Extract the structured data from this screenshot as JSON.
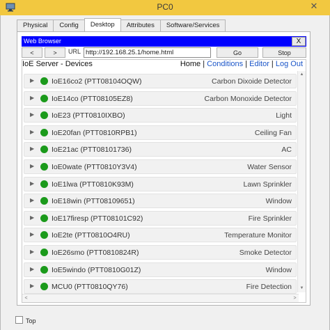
{
  "window": {
    "title": "PC0",
    "close_glyph": "✕"
  },
  "tabs": [
    {
      "label": "Physical",
      "active": false
    },
    {
      "label": "Config",
      "active": false
    },
    {
      "label": "Desktop",
      "active": true
    },
    {
      "label": "Attributes",
      "active": false
    },
    {
      "label": "Software/Services",
      "active": false
    }
  ],
  "browser": {
    "title": "Web Browser",
    "close_label": "X",
    "back_label": "<",
    "forward_label": ">",
    "url_label": "URL",
    "url_value": "http://192.168.25.1/home.html",
    "go_label": "Go",
    "stop_label": "Stop"
  },
  "page": {
    "title": "IoE Server - Devices",
    "links": [
      "Home",
      "Conditions",
      "Editor",
      "Log Out"
    ],
    "separator": " | "
  },
  "devices": [
    {
      "name": "IoE16co2 (PTT08104OQW)",
      "type": "Carbon Dixoide Detector",
      "status_color": "#1b9a1b"
    },
    {
      "name": "IoE14co (PTT08105EZ8)",
      "type": "Carbon Monoxide Detector",
      "status_color": "#1b9a1b"
    },
    {
      "name": "IoE23 (PTT0810IXBO)",
      "type": "Light",
      "status_color": "#1b9a1b"
    },
    {
      "name": "IoE20fan (PTT0810RPB1)",
      "type": "Ceiling Fan",
      "status_color": "#1b9a1b"
    },
    {
      "name": "IoE21ac (PTT08101736)",
      "type": "AC",
      "status_color": "#1b9a1b"
    },
    {
      "name": "IoE0wate (PTT0810Y3V4)",
      "type": "Water Sensor",
      "status_color": "#1b9a1b"
    },
    {
      "name": "IoE1lwa (PTT0810K93M)",
      "type": "Lawn Sprinkler",
      "status_color": "#1b9a1b"
    },
    {
      "name": "IoE18win (PTT08109651)",
      "type": "Window",
      "status_color": "#1b9a1b"
    },
    {
      "name": "IoE17firesp (PTT08101C92)",
      "type": "Fire Sprinkler",
      "status_color": "#1b9a1b"
    },
    {
      "name": "IoE2te (PTT0810O4RU)",
      "type": "Temperature Monitor",
      "status_color": "#1b9a1b"
    },
    {
      "name": "IoE26smo (PTT0810824R)",
      "type": "Smoke Detector",
      "status_color": "#1b9a1b"
    },
    {
      "name": "IoE5windo (PTT0810G01Z)",
      "type": "Window",
      "status_color": "#1b9a1b"
    },
    {
      "name": "MCU0 (PTT0810QY76)",
      "type": "Fire Detection",
      "status_color": "#1b9a1b"
    }
  ],
  "footer": {
    "top_label": "Top",
    "top_checked": false
  },
  "colors": {
    "titlebar": "#f2c840",
    "browser_bar": "#0000ff",
    "link": "#1a55c8",
    "status_on": "#1b9a1b"
  }
}
